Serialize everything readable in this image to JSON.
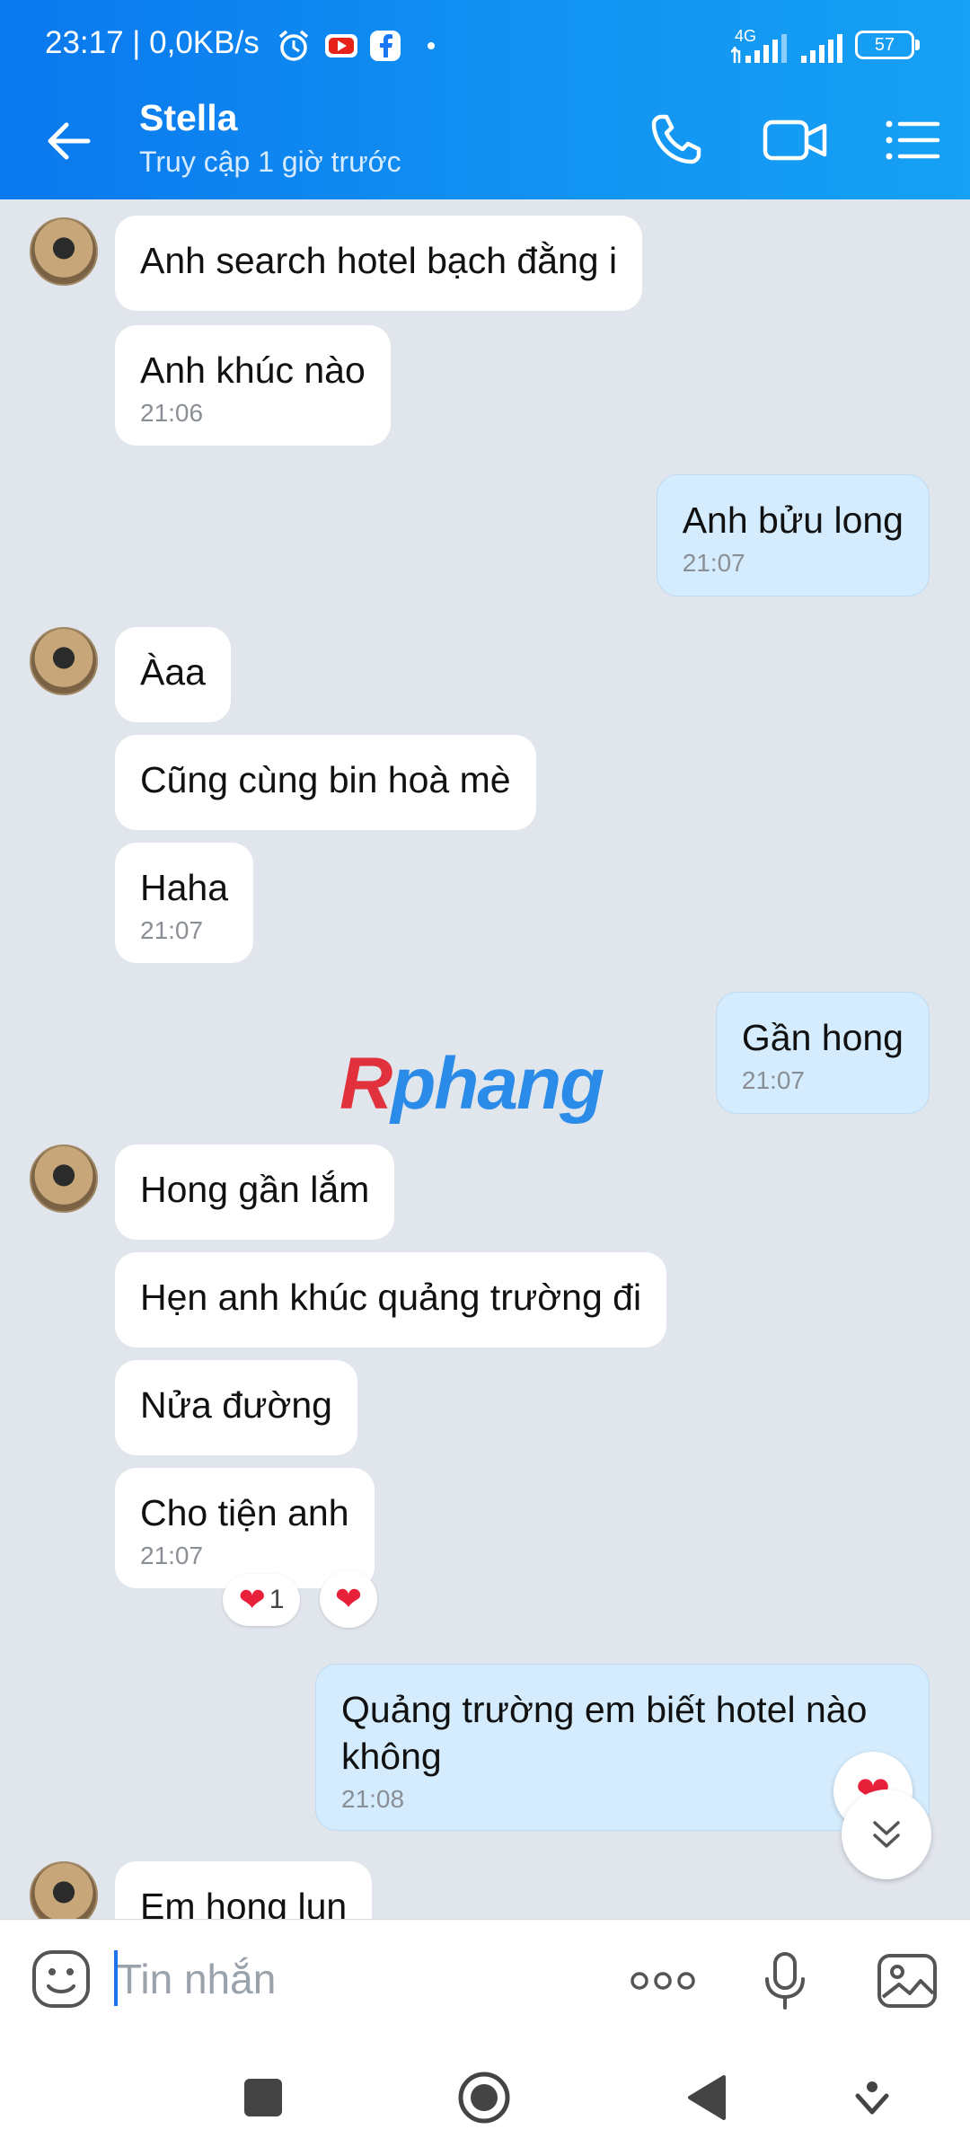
{
  "status_bar": {
    "time_speed": "23:17 | 0,0KB/s",
    "network": "4G",
    "battery": "57",
    "icons": [
      "alarm-icon",
      "youtube-icon",
      "facebook-icon",
      "dot-icon",
      "signal-icon",
      "battery-icon"
    ]
  },
  "header": {
    "name": "Stella",
    "last_seen": "Truy cập 1 giờ trước",
    "icons": [
      "back-arrow-icon",
      "phone-icon",
      "video-icon",
      "list-menu-icon"
    ]
  },
  "messages": [
    {
      "side": "in",
      "text": "Anh search hotel bạch đằng i",
      "time": ""
    },
    {
      "side": "in",
      "text": "Anh khúc nào",
      "time": "21:06"
    },
    {
      "side": "out",
      "text": "Anh bửu long",
      "time": "21:07"
    },
    {
      "side": "in",
      "text": "Àaa",
      "time": ""
    },
    {
      "side": "in",
      "text": "Cũng cùng bin hoà mè",
      "time": ""
    },
    {
      "side": "in",
      "text": "Haha",
      "time": "21:07"
    },
    {
      "side": "out",
      "text": "Gần hong",
      "time": "21:07"
    },
    {
      "side": "in",
      "text": "Hong gần lắm",
      "time": ""
    },
    {
      "side": "in",
      "text": "Hẹn anh khúc quảng trường đi",
      "time": ""
    },
    {
      "side": "in",
      "text": "Nửa đường",
      "time": ""
    },
    {
      "side": "in",
      "text": "Cho tiện anh",
      "time": "21:07"
    },
    {
      "side": "out",
      "text": "Quảng trường em biết hotel nào không",
      "line1": "Quảng trường em biết hotel nào",
      "line2": "không",
      "time": "21:08"
    },
    {
      "side": "in",
      "text": "Em hong lun",
      "time": ""
    }
  ],
  "reactions": {
    "count": "1",
    "heart": "❤"
  },
  "watermark": {
    "first": "R",
    "rest": "phang"
  },
  "input": {
    "placeholder": "Tin nhắn",
    "icons": [
      "emoji-icon",
      "more-icon",
      "microphone-icon",
      "image-icon"
    ]
  },
  "navbar": {
    "icons": [
      "recent-apps-icon",
      "home-icon",
      "back-icon",
      "dropdown-icon"
    ]
  },
  "colors": {
    "header_blue": "#0a78ee",
    "outgoing_bubble": "#d4ecfd",
    "incoming_bubble": "#ffffff",
    "chat_background": "#e1e5ec"
  }
}
